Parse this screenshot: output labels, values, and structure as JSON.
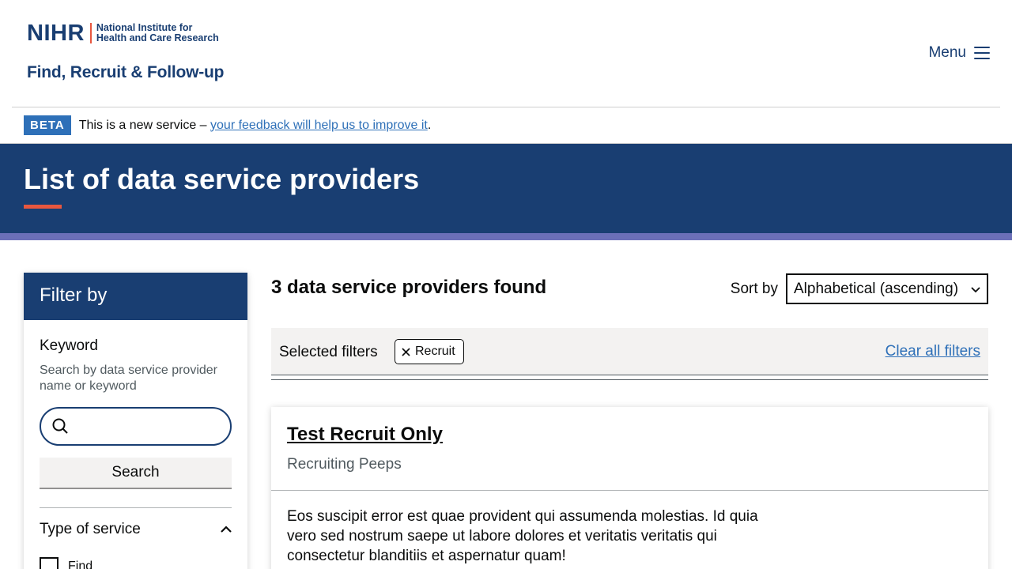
{
  "header": {
    "logo_mark": "NIHR",
    "logo_line1": "National Institute for",
    "logo_line2": "Health and Care Research",
    "app_title": "Find, Recruit & Follow-up",
    "menu_label": "Menu"
  },
  "beta": {
    "tag": "BETA",
    "text_before": "This is a new service – ",
    "link": "your feedback will help us to improve it",
    "text_after": "."
  },
  "page": {
    "title": "List of data service providers"
  },
  "filter": {
    "heading": "Filter by",
    "keyword_label": "Keyword",
    "keyword_hint": "Search by data service provider name or keyword",
    "keyword_value": "",
    "search_button": "Search",
    "type_of_service_label": "Type of service",
    "options": [
      {
        "label": "Find",
        "checked": false
      }
    ]
  },
  "results": {
    "count_text": "3 data service providers found",
    "sort_label": "Sort by",
    "sort_selected": "Alphabetical (ascending)",
    "selected_filters_label": "Selected filters",
    "chips": [
      "Recruit"
    ],
    "clear_all": "Clear all filters"
  },
  "cards": [
    {
      "title": "Test Recruit Only",
      "subtitle": "Recruiting Peeps",
      "description": "Eos suscipit error est quae provident qui assumenda molestias. Id quia vero sed nostrum saepe ut labore dolores et veritatis veritatis qui consectetur blanditiis et aspernatur quam!"
    }
  ],
  "colors": {
    "brand_navy": "#193e72",
    "accent_red": "#e8573f",
    "band_purple": "#6b6fb8",
    "link_blue": "#2e70b8"
  }
}
